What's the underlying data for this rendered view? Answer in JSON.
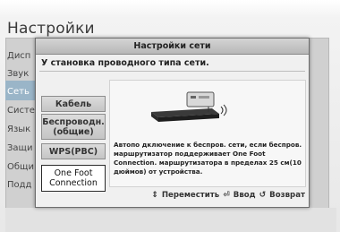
{
  "background": {
    "title": "Настройки",
    "menu_items": [
      "Дисп",
      "Звук",
      "Сеть",
      "Систе",
      "Язык",
      "Защи",
      "Общи",
      "Подд"
    ]
  },
  "dialog": {
    "title": "Настройки сети",
    "subtitle": "У становка проводного типа сети.",
    "options": [
      "Кабель",
      "Беспроводн. (общие)",
      "WPS(PBC)",
      "One Foot Connection"
    ],
    "selected_option": "One Foot Connection",
    "description": "Автопо дключение к беспров. сети, если беспров. маршрутизатор поддерживает One Foot Connection. маршрутизатора в пределах 25 см(10 дюймов) от устройства.",
    "footer": {
      "move": "Переместить",
      "enter": "Ввод",
      "back": "Возврат"
    }
  },
  "icons": {
    "move": "up-down-arrow-icon",
    "enter": "enter-icon",
    "back": "return-icon"
  },
  "colors": {
    "menu_highlight": "#9ab5c8",
    "dialog_bg": "#f0f0f0",
    "selected_button": "#ffffff"
  }
}
